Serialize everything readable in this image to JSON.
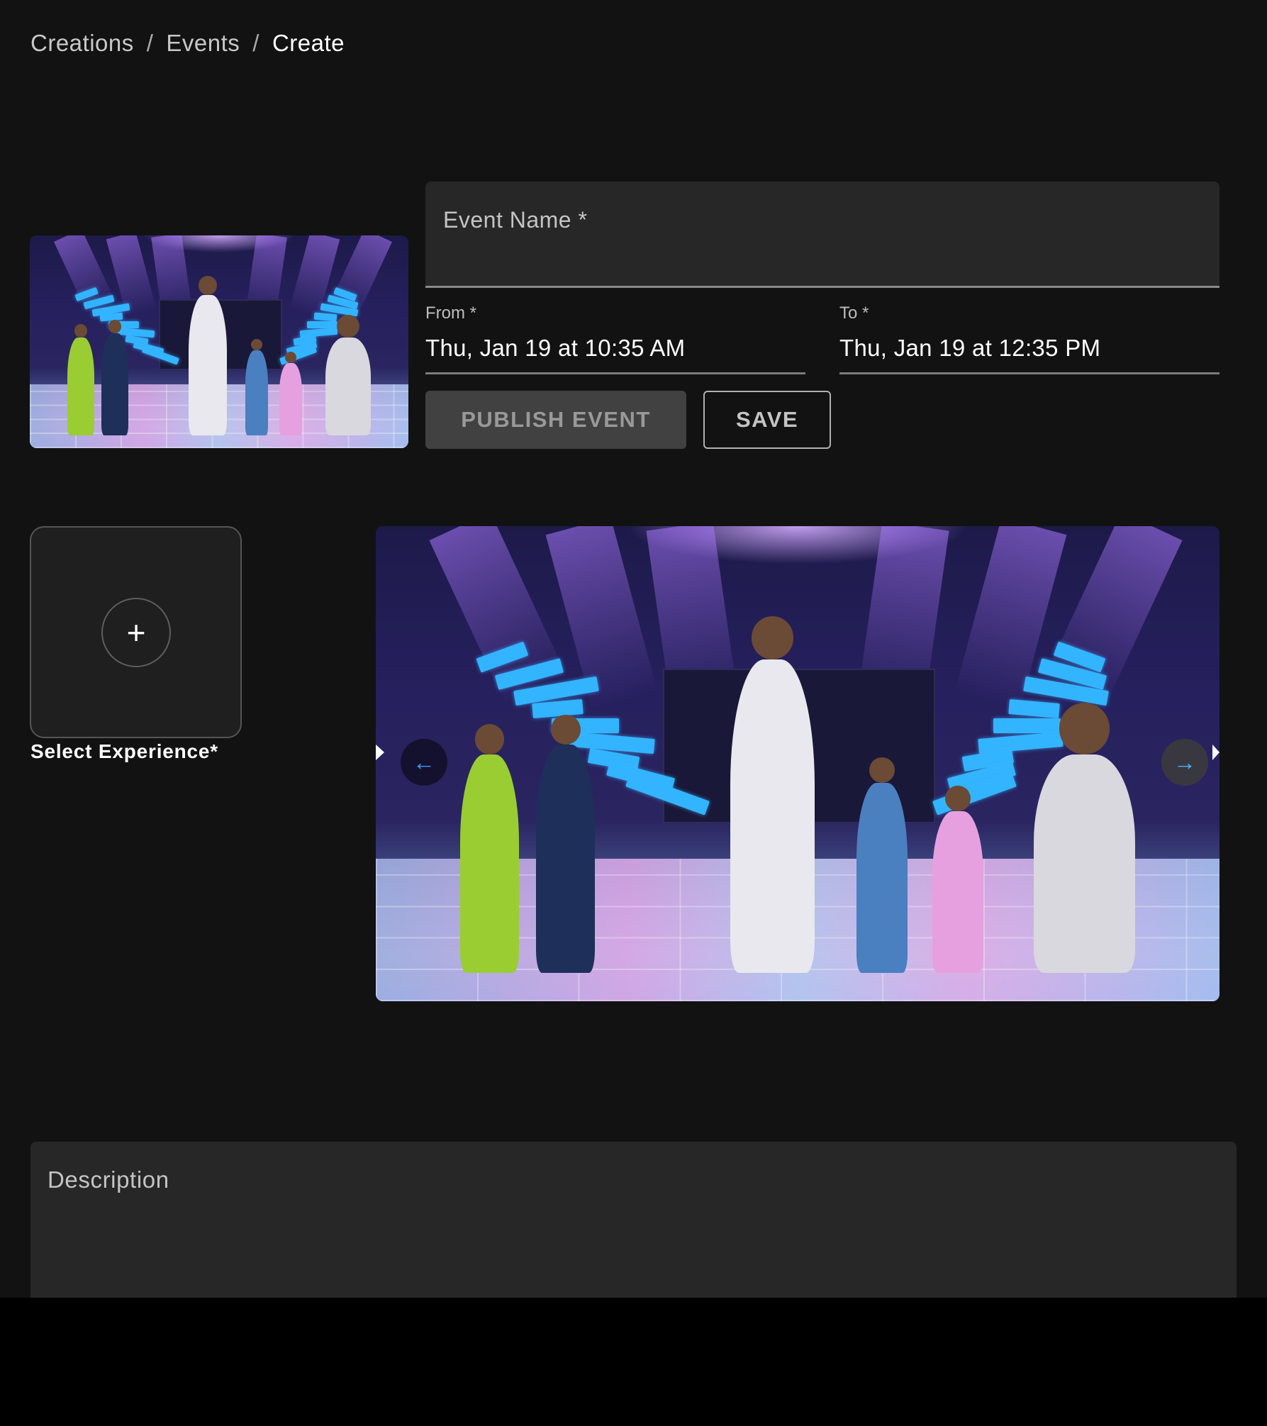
{
  "breadcrumb": {
    "items": [
      "Creations",
      "Events",
      "Create"
    ],
    "separator": "/"
  },
  "event_name": {
    "label": "Event Name *",
    "value": ""
  },
  "schedule": {
    "from": {
      "label": "From *",
      "value": "Thu, Jan 19 at 10:35 AM"
    },
    "to": {
      "label": "To *",
      "value": "Thu, Jan 19 at 12:35 PM"
    }
  },
  "actions": {
    "publish_label": "PUBLISH EVENT",
    "save_label": "SAVE"
  },
  "experience": {
    "label": "Select Experience*",
    "add_icon": "plus-icon",
    "add_glyph": "+"
  },
  "gallery": {
    "thumbnail_alt": "Avatars dancing on a lit stage",
    "hero_alt": "Avatars dancing on a lit stage",
    "prev_glyph": "←",
    "next_glyph": "→"
  },
  "description": {
    "label": "Description",
    "value": ""
  },
  "colors": {
    "background": "#121212",
    "field": "#272727",
    "accent_arrow": "#3f9cff"
  }
}
